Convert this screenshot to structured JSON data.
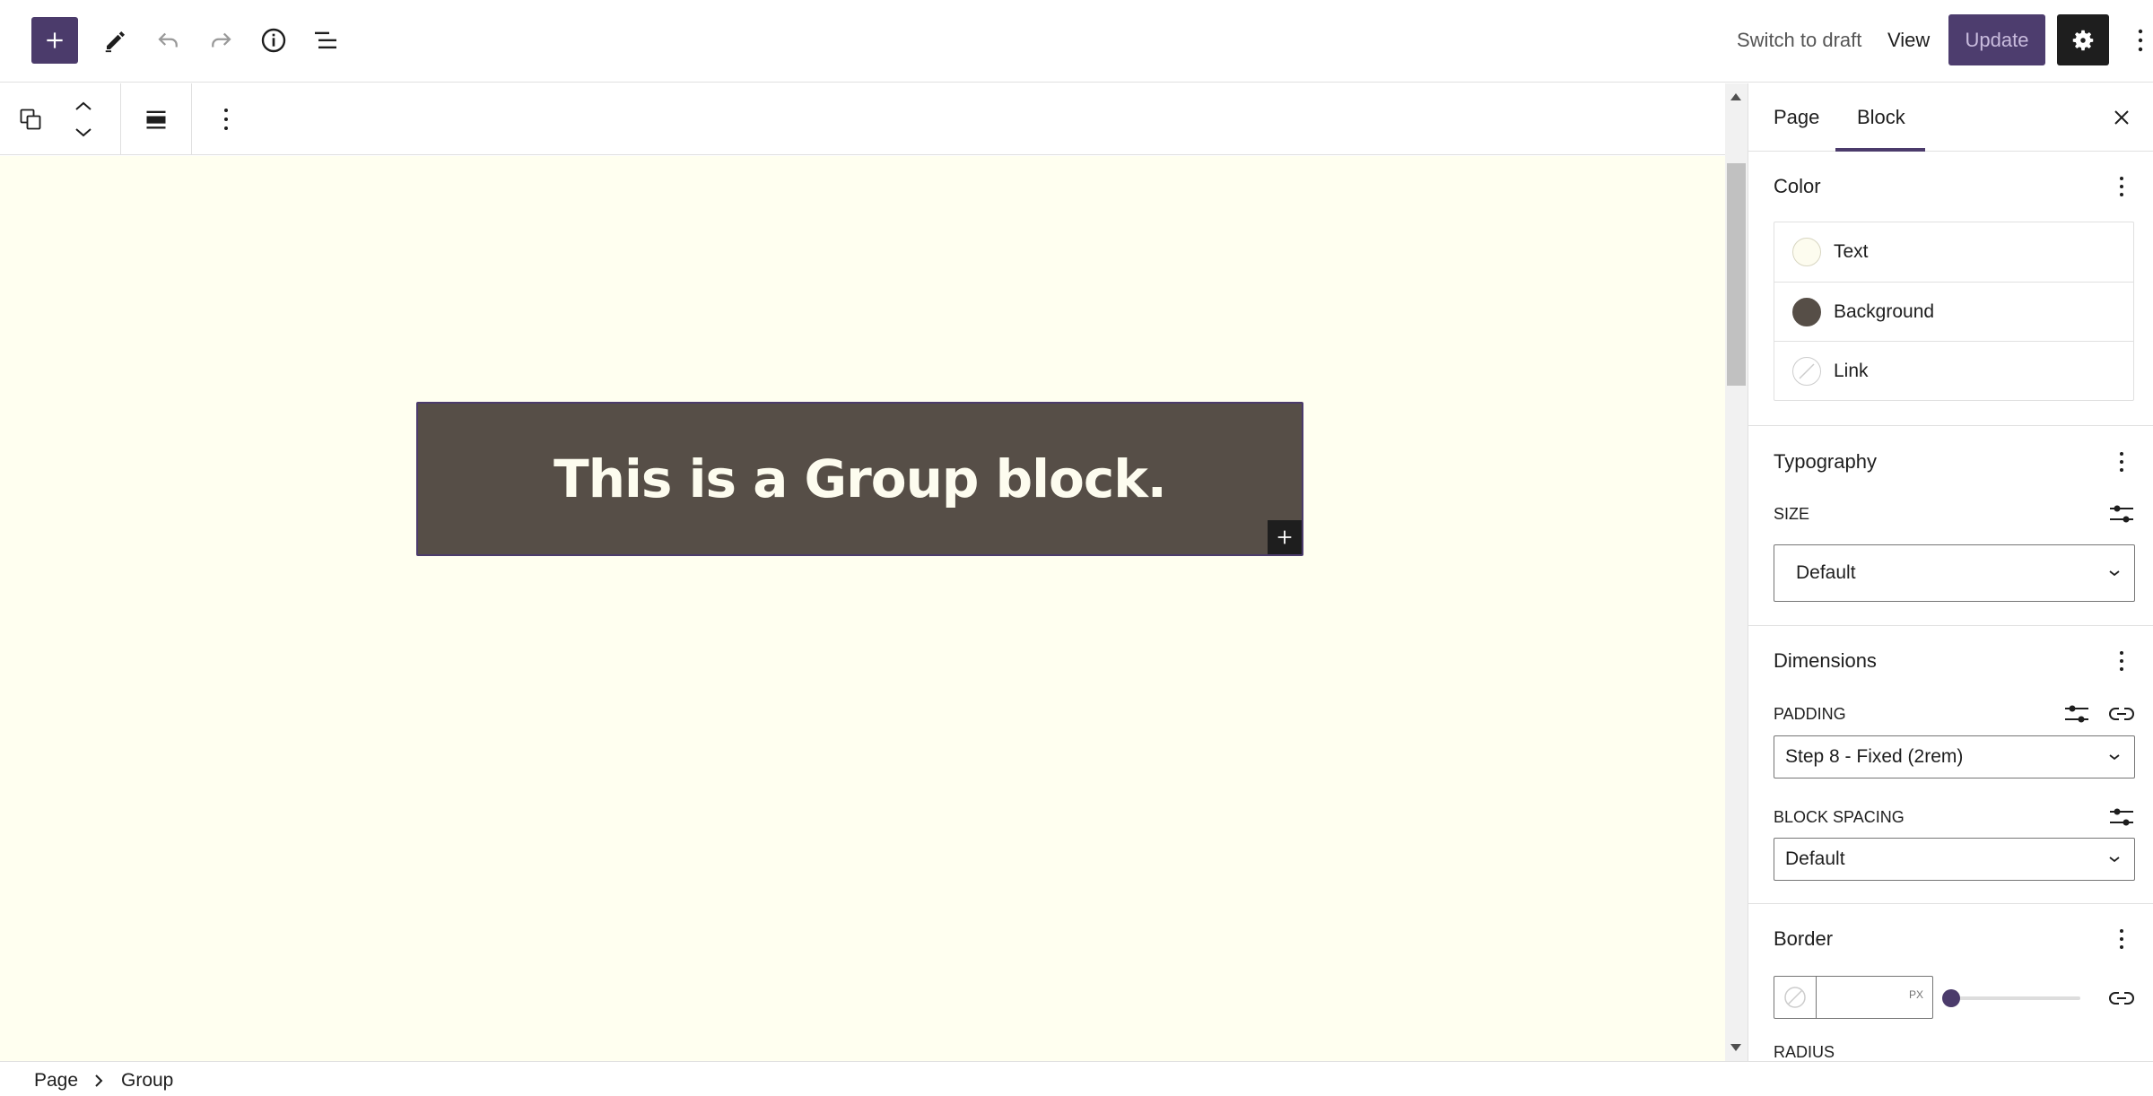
{
  "header": {
    "switch_to_draft": "Switch to draft",
    "view": "View",
    "update": "Update"
  },
  "icons": {
    "inserter": "plus-icon",
    "tools": "pencil-icon",
    "undo": "undo-icon",
    "redo": "redo-icon",
    "details": "info-icon",
    "list_view": "list-view-icon",
    "settings": "gear-icon",
    "options": "more-vertical-icon"
  },
  "canvas": {
    "group_heading": "This is a Group block.",
    "background_color": "#fffff0",
    "group_background": "#564e47",
    "group_text_color": "#fdfcef"
  },
  "sidebar": {
    "tabs": [
      {
        "label": "Page"
      },
      {
        "label": "Block"
      }
    ],
    "color": {
      "title": "Color",
      "items": [
        {
          "label": "Text",
          "swatch": "#fdfcef"
        },
        {
          "label": "Background",
          "swatch": "#564e47"
        },
        {
          "label": "Link",
          "swatch": "none"
        }
      ]
    },
    "typography": {
      "title": "Typography",
      "size_label": "SIZE",
      "size_value": "Default"
    },
    "dimensions": {
      "title": "Dimensions",
      "padding_label": "PADDING",
      "padding_value": "Step 8 - Fixed (2rem)",
      "block_spacing_label": "BLOCK SPACING",
      "block_spacing_value": "Default"
    },
    "border": {
      "title": "Border",
      "unit": "PX",
      "radius_label": "RADIUS",
      "width_value": 0
    }
  },
  "breadcrumb": {
    "items": [
      "Page",
      "Group"
    ]
  },
  "theme": {
    "accent": "#4b3b6b",
    "update_bg": "#4d3d6e"
  }
}
